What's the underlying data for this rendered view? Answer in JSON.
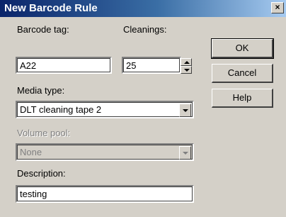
{
  "window": {
    "title": "New Barcode Rule",
    "close_label": "×"
  },
  "form": {
    "barcode_tag": {
      "label": "Barcode tag:",
      "value": "A22"
    },
    "cleanings": {
      "label": "Cleanings:",
      "value": "25"
    },
    "media_type": {
      "label": "Media type:",
      "value": "DLT cleaning tape 2"
    },
    "volume_pool": {
      "label": "Volume pool:",
      "value": "None",
      "disabled": true
    },
    "description": {
      "label": "Description:",
      "value": "testing"
    }
  },
  "buttons": {
    "ok": "OK",
    "cancel": "Cancel",
    "help": "Help"
  }
}
